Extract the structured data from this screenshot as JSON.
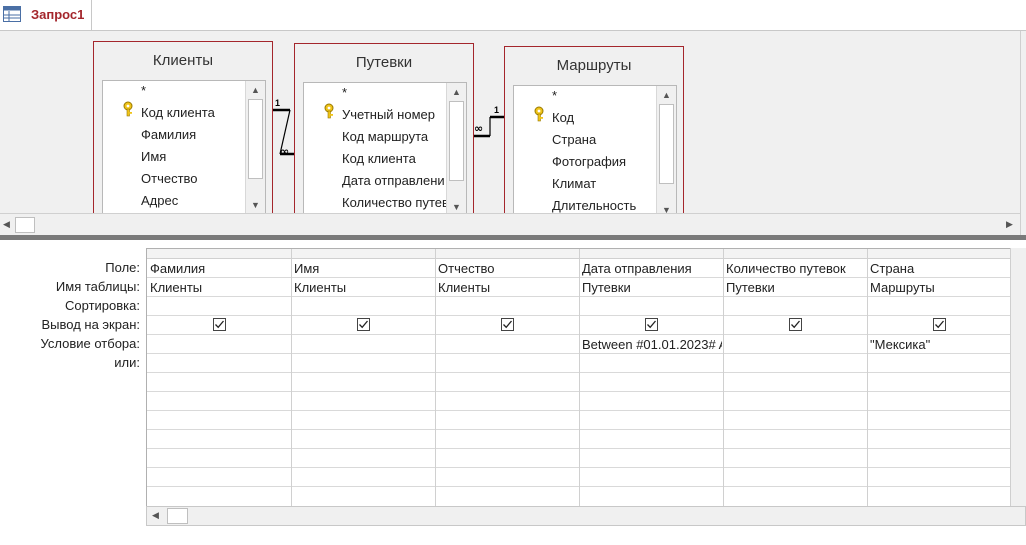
{
  "tab": {
    "label": "Запрос1",
    "icon": "query-icon"
  },
  "tables": [
    {
      "title": "Клиенты",
      "fields": [
        "*",
        "Код клиента",
        "Фамилия",
        "Имя",
        "Отчество",
        "Адрес"
      ]
    },
    {
      "title": "Путевки",
      "fields": [
        "*",
        "Учетный номер",
        "Код маршрута",
        "Код клиента",
        "Дата отправлени",
        "Количество путев"
      ]
    },
    {
      "title": "Маршруты",
      "fields": [
        "*",
        "Код",
        "Страна",
        "Фотография",
        "Климат",
        "Длительность"
      ]
    }
  ],
  "relations": [
    {
      "one": "1",
      "many": "∞"
    },
    {
      "one": "1",
      "many": "∞"
    }
  ],
  "row_labels": [
    "Поле:",
    "Имя таблицы:",
    "Сортировка:",
    "Вывод на экран:",
    "Условие отбора:",
    "или:"
  ],
  "columns": [
    {
      "field": "Фамилия",
      "table": "Клиенты",
      "sort": "",
      "show": true,
      "criteria": "",
      "or": ""
    },
    {
      "field": "Имя",
      "table": "Клиенты",
      "sort": "",
      "show": true,
      "criteria": "",
      "or": ""
    },
    {
      "field": "Отчество",
      "table": "Клиенты",
      "sort": "",
      "show": true,
      "criteria": "",
      "or": ""
    },
    {
      "field": "Дата отправления",
      "table": "Путевки",
      "sort": "",
      "show": true,
      "criteria": "Between #01.01.2023# A",
      "or": ""
    },
    {
      "field": "Количество путевок",
      "table": "Путевки",
      "sort": "",
      "show": true,
      "criteria": "",
      "or": ""
    },
    {
      "field": "Страна",
      "table": "Маршруты",
      "sort": "",
      "show": true,
      "criteria": "\"Мексика\"",
      "or": ""
    }
  ]
}
